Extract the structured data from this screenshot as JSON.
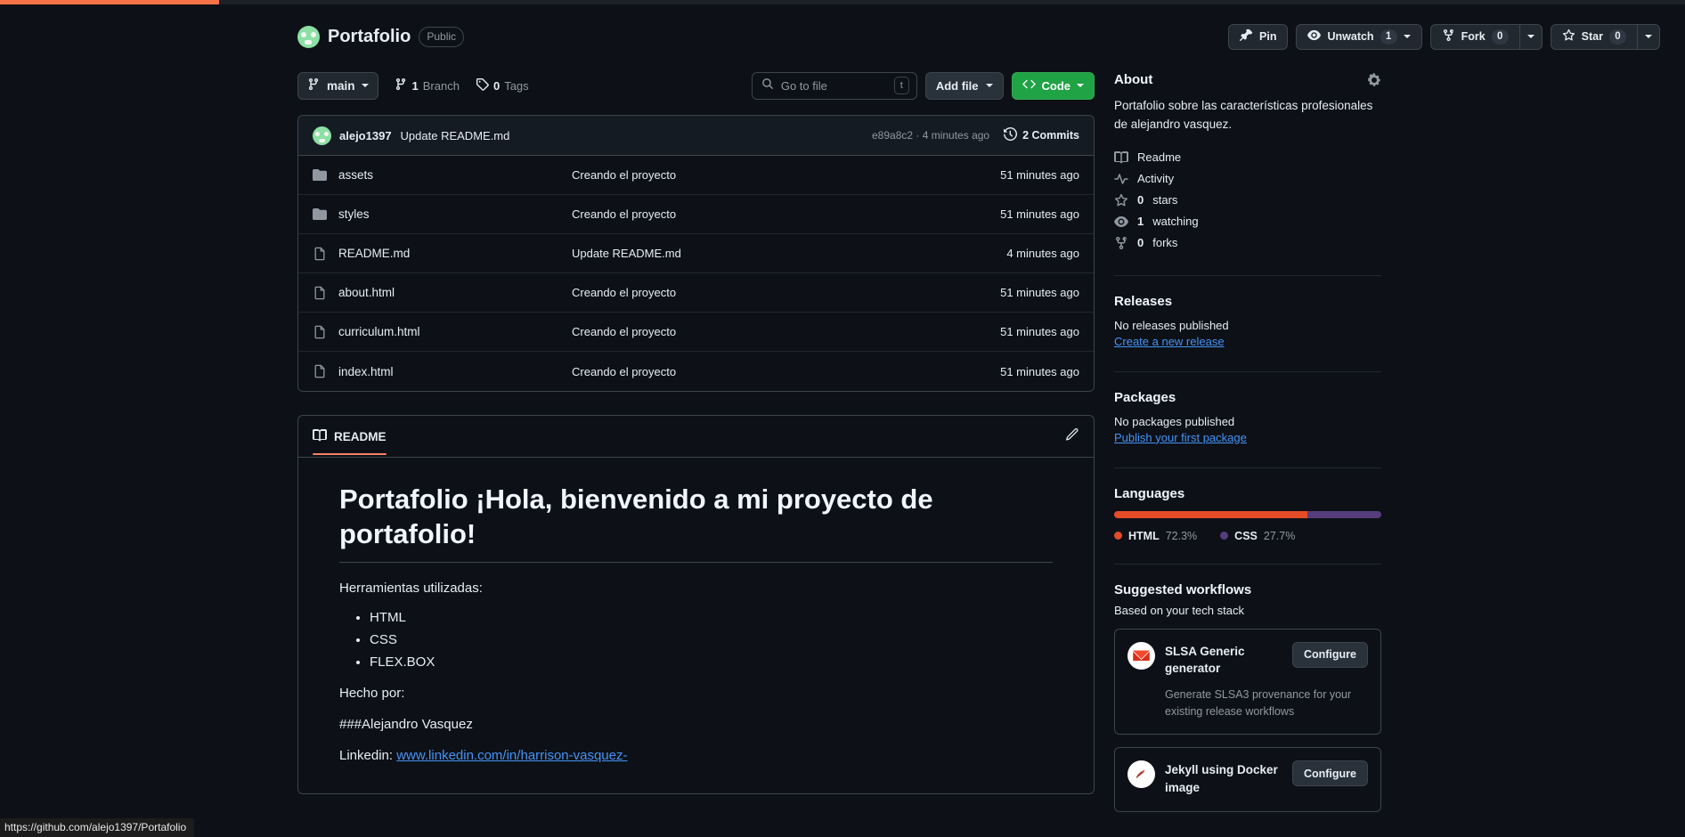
{
  "progress": {
    "percent": 13,
    "color": "#f97348"
  },
  "status_bar": {
    "url": "https://github.com/alejo1397/Portafolio"
  },
  "repo": {
    "name": "Portafolio",
    "visibility": "Public",
    "actions": {
      "pin": "Pin",
      "watch": "Unwatch",
      "watch_count": "1",
      "fork": "Fork",
      "fork_count": "0",
      "star": "Star",
      "star_count": "0"
    }
  },
  "toolbar": {
    "branch": "main",
    "branch_count": "1",
    "branch_label": "Branch",
    "tag_count": "0",
    "tag_label": "Tags",
    "goto_file_placeholder": "Go to file",
    "goto_file_key": "t",
    "add_file": "Add file",
    "code": "Code"
  },
  "commit_bar": {
    "author": "alejo1397",
    "message": "Update README.md",
    "hash_time": "e89a8c2 · 4 minutes ago",
    "commits": "2 Commits"
  },
  "files": [
    {
      "icon": "folder-icon",
      "type": "folder",
      "name": "assets",
      "commit": "Creando el proyecto",
      "time": "51 minutes ago"
    },
    {
      "icon": "folder-icon",
      "type": "folder",
      "name": "styles",
      "commit": "Creando el proyecto",
      "time": "51 minutes ago"
    },
    {
      "icon": "file-icon",
      "type": "file",
      "name": "README.md",
      "commit": "Update README.md",
      "time": "4 minutes ago"
    },
    {
      "icon": "file-icon",
      "type": "file",
      "name": "about.html",
      "commit": "Creando el proyecto",
      "time": "51 minutes ago"
    },
    {
      "icon": "file-icon",
      "type": "file",
      "name": "curriculum.html",
      "commit": "Creando el proyecto",
      "time": "51 minutes ago"
    },
    {
      "icon": "file-icon",
      "type": "file",
      "name": "index.html",
      "commit": "Creando el proyecto",
      "time": "51 minutes ago"
    }
  ],
  "readme": {
    "tab": "README",
    "heading": "Portafolio ¡Hola, bienvenido a mi proyecto de portafolio!",
    "intro": "Herramientas utilizadas:",
    "tools": [
      "HTML",
      "CSS",
      "FLEX.BOX"
    ],
    "made_by_label": "Hecho por:",
    "author": "###Alejandro Vasquez",
    "linkedin_label": "Linkedin:",
    "linkedin_url": "www.linkedin.com/in/harrison-vasquez-"
  },
  "about": {
    "title": "About",
    "description": "Portafolio sobre las características profesionales de alejandro vasquez.",
    "links": [
      {
        "icon": "book-icon",
        "label": "Readme",
        "value": ""
      },
      {
        "icon": "activity-icon",
        "label": "Activity",
        "value": ""
      },
      {
        "icon": "star-icon",
        "label": "stars",
        "value": "0"
      },
      {
        "icon": "eye-icon",
        "label": "watching",
        "value": "1"
      },
      {
        "icon": "fork-icon",
        "label": "forks",
        "value": "0"
      }
    ]
  },
  "releases": {
    "title": "Releases",
    "empty": "No releases published",
    "link": "Create a new release"
  },
  "packages": {
    "title": "Packages",
    "empty": "No packages published",
    "link": "Publish your first package"
  },
  "languages": {
    "title": "Languages",
    "items": [
      {
        "name": "HTML",
        "percent": "72.3%",
        "value": 72.3,
        "color": "#e34c26"
      },
      {
        "name": "CSS",
        "percent": "27.7%",
        "value": 27.7,
        "color": "#563d7c"
      }
    ]
  },
  "workflows": {
    "title": "Suggested workflows",
    "subtitle": "Based on your tech stack",
    "configure_label": "Configure",
    "cards": [
      {
        "logo": "slsa-icon",
        "title": "SLSA Generic generator",
        "desc": "Generate SLSA3 provenance for your existing release workflows"
      },
      {
        "logo": "jekyll-icon",
        "title": "Jekyll using Docker image",
        "desc": ""
      }
    ]
  }
}
